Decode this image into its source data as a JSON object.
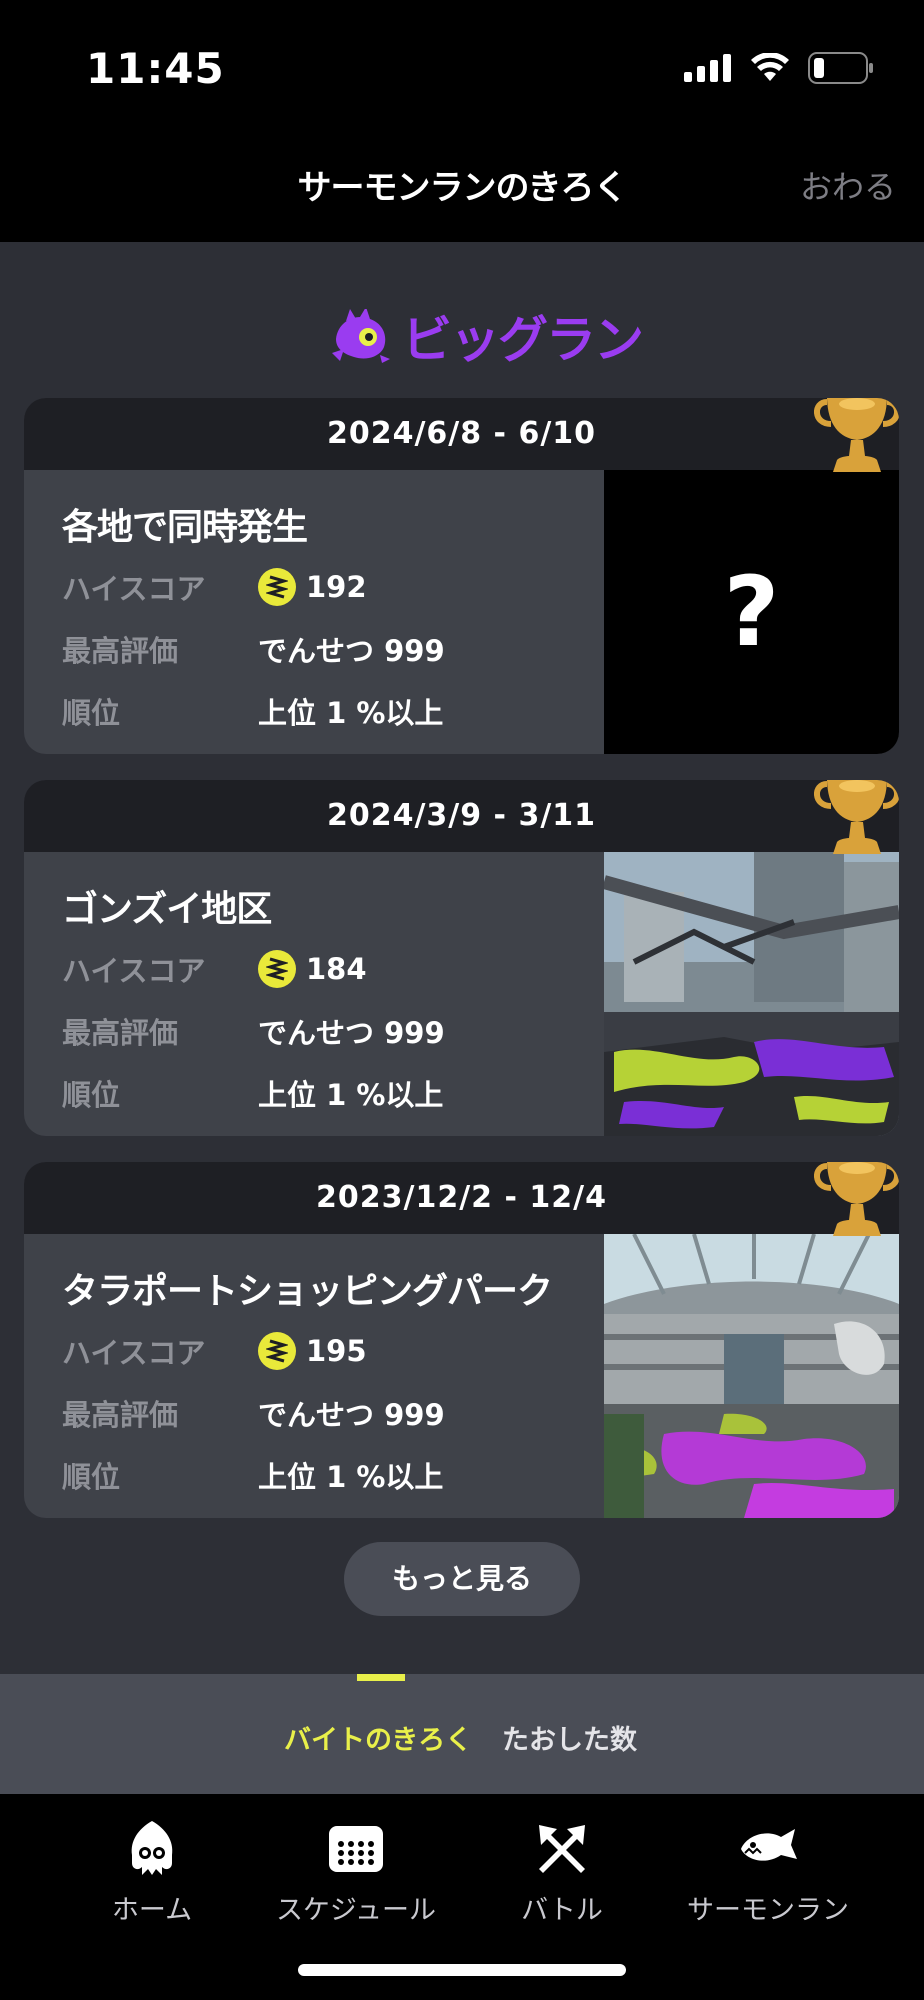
{
  "status_bar": {
    "time": "11:45"
  },
  "header": {
    "title": "サーモンランのきろく",
    "close_label": "おわる"
  },
  "section": {
    "title": "ビッグラン"
  },
  "cards": [
    {
      "date": "2024/6/8 - 6/10",
      "stage": "各地で同時発生",
      "high_score_label": "ハイスコア",
      "high_score": "192",
      "best_grade_label": "最高評価",
      "best_grade": "でんせつ 999",
      "rank_label": "順位",
      "rank": "上位 1 %以上",
      "image": "?"
    },
    {
      "date": "2024/3/9 - 3/11",
      "stage": "ゴンズイ地区",
      "high_score_label": "ハイスコア",
      "high_score": "184",
      "best_grade_label": "最高評価",
      "best_grade": "でんせつ 999",
      "rank_label": "順位",
      "rank": "上位 1 %以上"
    },
    {
      "date": "2023/12/2 - 12/4",
      "stage": "タラポートショッピングパーク",
      "high_score_label": "ハイスコア",
      "high_score": "195",
      "best_grade_label": "最高評価",
      "best_grade": "でんせつ 999",
      "rank_label": "順位",
      "rank": "上位 1 %以上"
    }
  ],
  "more_button": "もっと見る",
  "subtabs": {
    "active": "バイトのきろく",
    "inactive": "たおした数"
  },
  "tabbar": [
    {
      "label": "ホーム",
      "icon": "squid-icon"
    },
    {
      "label": "スケジュール",
      "icon": "calendar-icon"
    },
    {
      "label": "バトル",
      "icon": "crossed-arrows-icon"
    },
    {
      "label": "サーモンラン",
      "icon": "salmon-icon"
    }
  ],
  "colors": {
    "accent_yellow": "#e9f04a",
    "bigrun_purple": "#9a3cf0",
    "trophy_gold": "#d9a23a"
  }
}
